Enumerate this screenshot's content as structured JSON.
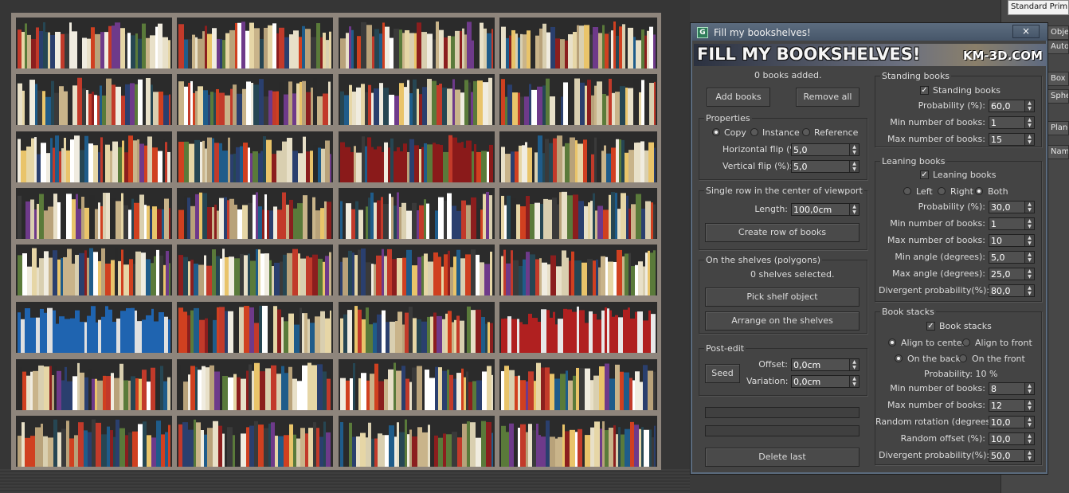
{
  "dialog": {
    "title": "Fill my bookshelves!",
    "close_label": "×",
    "icon_label": "G",
    "banner_title": "FILL MY BOOKSHELVES!",
    "banner_url": "KM-3D.COM",
    "status": "0 books added.",
    "add_books": "Add books",
    "remove_all": "Remove all",
    "properties": {
      "title": "Properties",
      "copy": "Copy",
      "instance": "Instance",
      "reference": "Reference",
      "hflip_label": "Horizontal flip (%):",
      "hflip": "5,0",
      "vflip_label": "Vertical flip (%):",
      "vflip": "5,0"
    },
    "single_row": {
      "title": "Single row in the center of viewport",
      "length_label": "Length:",
      "length": "100,0cm",
      "create_button": "Create row of books"
    },
    "on_shelves": {
      "title": "On the shelves (polygons)",
      "status": "0 shelves selected.",
      "pick_button": "Pick shelf object",
      "arrange_button": "Arrange on the shelves"
    },
    "post_edit": {
      "title": "Post-edit",
      "seed_button": "Seed",
      "offset_label": "Offset:",
      "offset": "0,0cm",
      "variation_label": "Variation:",
      "variation": "0,0cm"
    },
    "delete_last": "Delete last",
    "standing": {
      "title": "Standing books",
      "check_label": "Standing books",
      "prob_label": "Probability (%):",
      "prob": "60,0",
      "min_label": "Min number of books:",
      "min": "1",
      "max_label": "Max number of books:",
      "max": "15"
    },
    "leaning": {
      "title": "Leaning books",
      "check_label": "Leaning books",
      "left": "Left",
      "right": "Right",
      "both": "Both",
      "prob_label": "Probability (%):",
      "prob": "30,0",
      "min_label": "Min number of books:",
      "min": "1",
      "max_label": "Max number of books:",
      "max": "10",
      "min_angle_label": "Min angle (degrees):",
      "min_angle": "5,0",
      "max_angle_label": "Max angle (degrees):",
      "max_angle": "25,0",
      "div_label": "Divergent probability(%):",
      "div": "80,0"
    },
    "stacks": {
      "title": "Book stacks",
      "check_label": "Book stacks",
      "align_center": "Align to center",
      "align_front": "Align to front",
      "on_back": "On the back",
      "on_front": "On the front",
      "prob_text": "Probability:  10 %",
      "min_label": "Min number of books:",
      "min": "8",
      "max_label": "Max number of books:",
      "max": "12",
      "rot_label": "Random rotation (degrees):",
      "rot": "10,0",
      "off_label": "Random offset (%):",
      "off": "10,0",
      "div_label": "Divergent probability(%):",
      "div": "50,0"
    }
  },
  "side_panel": {
    "dropdown": "Standard Primitives",
    "tab1": "Object Type",
    "tab2": "AutoGrid",
    "tab3": "Box",
    "tab4": "Sphere",
    "tab5": "Plane",
    "tab6": "Name and Color"
  },
  "colors": {
    "viewport": "#363636",
    "shelf": "#8e857c",
    "dialog": "#444444",
    "titlebar": "#55657a"
  }
}
